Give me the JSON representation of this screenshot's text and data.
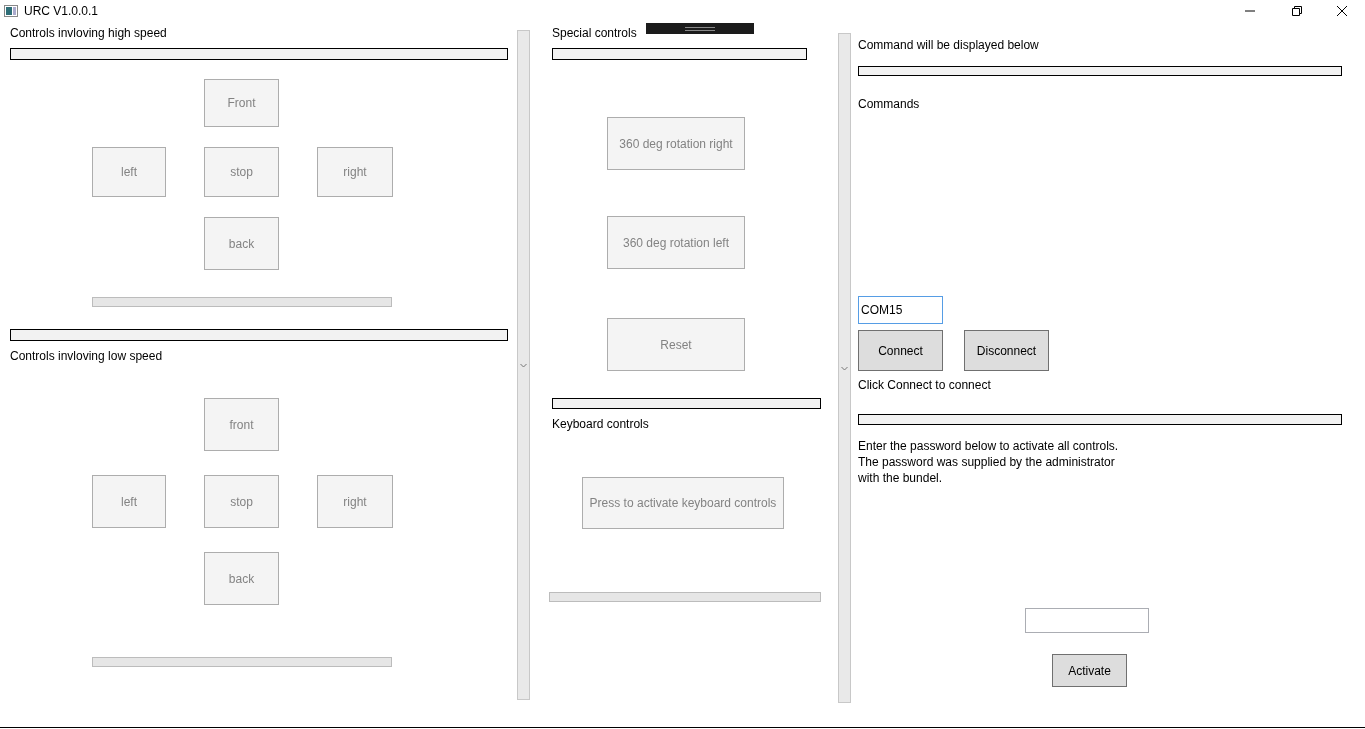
{
  "window": {
    "title": "URC V1.0.0.1"
  },
  "high_speed": {
    "heading": "Controls invloving high speed",
    "buttons": [
      {
        "label": "Front",
        "disabled": true
      },
      {
        "label": "left",
        "disabled": true
      },
      {
        "label": "stop",
        "disabled": true
      },
      {
        "label": "right",
        "disabled": true
      },
      {
        "label": "back",
        "disabled": true
      }
    ]
  },
  "low_speed": {
    "heading": "Controls invloving low speed",
    "buttons": [
      {
        "label": "front",
        "disabled": true
      },
      {
        "label": "left",
        "disabled": true
      },
      {
        "label": "stop",
        "disabled": true
      },
      {
        "label": "right",
        "disabled": true
      },
      {
        "label": "back",
        "disabled": true
      }
    ]
  },
  "special": {
    "heading": "Special controls",
    "buttons": [
      {
        "label": "360 deg rotation right",
        "disabled": true
      },
      {
        "label": "360 deg rotation left",
        "disabled": true
      },
      {
        "label": "Reset",
        "disabled": true
      }
    ]
  },
  "keyboard": {
    "heading": "Keyboard controls",
    "button": {
      "label": "Press to activate keyboard controls",
      "disabled": true
    }
  },
  "connection": {
    "command_heading": "Command will be displayed below",
    "commands_label": "Commands",
    "port_field": {
      "value": "COM15",
      "focused": true
    },
    "buttons": [
      {
        "label": "Connect",
        "disabled": false
      },
      {
        "label": "Disconnect",
        "disabled": false
      }
    ],
    "status": "Click Connect to connect"
  },
  "activation": {
    "instructions": "Enter the password below to activate all controls.\nThe password was supplied by the administrator\nwith the bundel.",
    "button": {
      "label": "Activate",
      "disabled": false
    }
  }
}
